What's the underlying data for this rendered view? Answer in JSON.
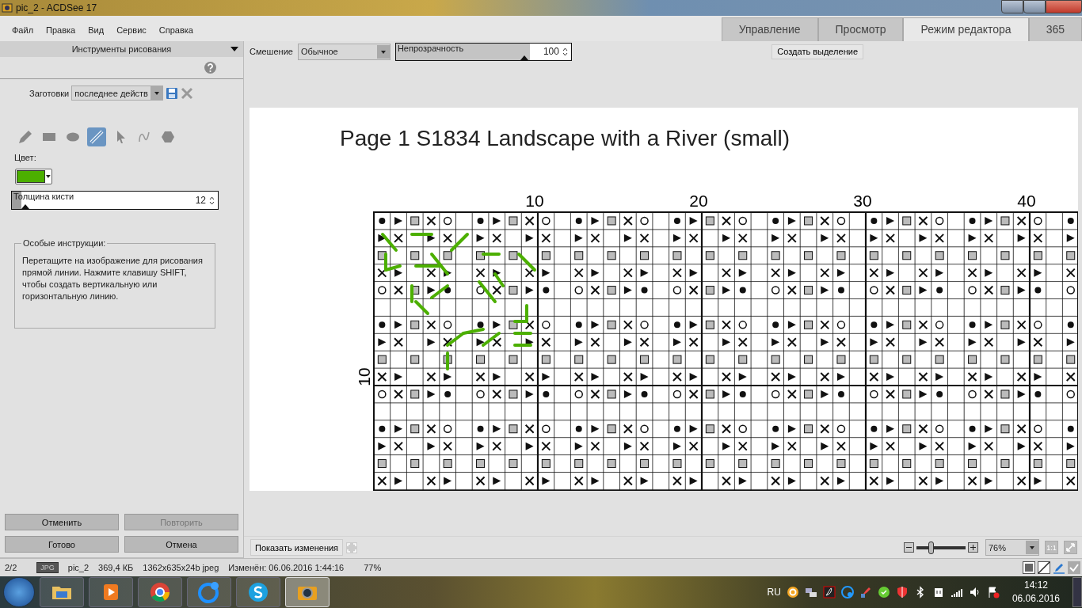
{
  "window": {
    "title": "pic_2 - ACDSee 17"
  },
  "menu": [
    "Файл",
    "Правка",
    "Вид",
    "Сервис",
    "Справка"
  ],
  "mode_tabs": [
    {
      "label": "Управление",
      "selected": false
    },
    {
      "label": "Просмотр",
      "selected": false
    },
    {
      "label": "Режим редактора",
      "selected": true
    },
    {
      "label": "365",
      "selected": false
    }
  ],
  "panel": {
    "title": "Инструменты рисования",
    "presets_label": "Заготовки",
    "presets_value": "последнее действ",
    "tools": [
      {
        "kind": "pencil",
        "selected": false
      },
      {
        "kind": "rectangle",
        "selected": false
      },
      {
        "kind": "ellipse",
        "selected": false
      },
      {
        "kind": "line",
        "selected": true
      },
      {
        "kind": "arrow",
        "selected": false
      },
      {
        "kind": "curve",
        "selected": false
      },
      {
        "kind": "polygon",
        "selected": false
      }
    ],
    "color_label": "Цвет:",
    "color": "#4caf00",
    "brush": {
      "label": "Толщина кисти",
      "value": "12",
      "level": 0.06
    },
    "instructions": {
      "title": "Особые инструкции:",
      "text": "Перетащите на изображение для рисования прямой линии. Нажмите клавишу SHIFT, чтобы создать вертикальную или горизонтальную линию."
    },
    "buttons": [
      {
        "label": "Отменить",
        "disabled": false
      },
      {
        "label": "Повторить",
        "disabled": true
      },
      {
        "label": "Готово",
        "disabled": false
      },
      {
        "label": "Отмена",
        "disabled": false
      }
    ]
  },
  "toolbar": {
    "blend_label": "Смешение",
    "blend_value": "Обычное",
    "opacity": {
      "label": "Непрозрачность",
      "value": "100",
      "level": 1
    },
    "select_button": "Создать выделение"
  },
  "image": {
    "title": "Page 1  S1834 Landscape with a River (small)",
    "column_numbers": [
      "10",
      "20",
      "30",
      "40"
    ],
    "row_number": "10"
  },
  "bottom": {
    "show_changes": "Показать изменения",
    "zoom": {
      "value": "76%",
      "level": 0.28
    },
    "actual_size": "1:1"
  },
  "status_bar": {
    "position": "2/2",
    "format": "JPG",
    "name": "pic_2",
    "size": "369,4 КБ",
    "dimensions": "1362x635x24b jpeg",
    "modified": "Изменён: 06.06.2016 1:44:16",
    "zoom": "77%"
  },
  "taskbar": {
    "apps": [
      {
        "kind": "folder",
        "selected": false
      },
      {
        "kind": "player",
        "selected": false
      },
      {
        "kind": "chrome",
        "selected": false
      },
      {
        "kind": "globe",
        "selected": false
      },
      {
        "kind": "skype",
        "selected": false
      },
      {
        "kind": "camera",
        "selected": true
      }
    ],
    "language": "RU",
    "time": "14:12",
    "date": "06.06.2016"
  }
}
